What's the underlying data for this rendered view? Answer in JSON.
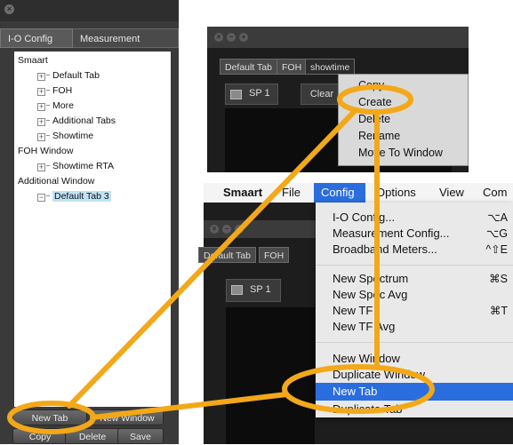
{
  "left_panel": {
    "close_glyph": "×",
    "tabs": [
      "I-O Config",
      "Measurement Config"
    ],
    "tree": [
      {
        "label": "Smaart",
        "level": 0
      },
      {
        "label": "Default Tab",
        "level": 1
      },
      {
        "label": "FOH",
        "level": 1
      },
      {
        "label": "More",
        "level": 1
      },
      {
        "label": "Additional Tabs",
        "level": 1
      },
      {
        "label": "Showtime",
        "level": 1
      },
      {
        "label": "FOH Window",
        "level": 0
      },
      {
        "label": "Showtime RTA",
        "level": 1
      },
      {
        "label": "Additional Window",
        "level": 0
      },
      {
        "label": "Default Tab 3",
        "level": 1,
        "selected": true
      }
    ],
    "buttons": {
      "new_tab": "New Tab",
      "new_window": "New Window",
      "copy": "Copy",
      "delete": "Delete",
      "save": "Save"
    }
  },
  "top_window": {
    "tabs": [
      "Default Tab",
      "FOH",
      "showtime"
    ],
    "sp_label": "SP 1",
    "clear_label": "Clear",
    "context_menu": [
      "Copy",
      "Create",
      "Delete",
      "Rename",
      "Move To Window"
    ]
  },
  "menu_bar": {
    "items": [
      "Smaart",
      "File",
      "Config",
      "Options",
      "View",
      "Com"
    ]
  },
  "bottom_window": {
    "tabs": [
      "Default Tab",
      "FOH"
    ],
    "sp_label": "SP 1"
  },
  "config_menu": {
    "items": [
      {
        "label": "I-O Config...",
        "shortcut": "⌥A"
      },
      {
        "label": "Measurement Config...",
        "shortcut": "⌥G"
      },
      {
        "label": "Broadband Meters...",
        "shortcut": "^⇧E"
      },
      {
        "label": "New Spectrum",
        "shortcut": "⌘S"
      },
      {
        "label": "New Spec Avg",
        "shortcut": ""
      },
      {
        "label": "New TF",
        "shortcut": "⌘T"
      },
      {
        "label": "New TF Avg",
        "shortcut": ""
      },
      {
        "label": "New Window",
        "shortcut": ""
      },
      {
        "label": "Duplicate Window",
        "shortcut": ""
      },
      {
        "label": "New Tab",
        "shortcut": ""
      },
      {
        "label": "Duplicate Tab",
        "shortcut": ""
      }
    ],
    "highlighted": "New Tab"
  },
  "colors": {
    "annotation": "#F2A818",
    "menu_highlight": "#2A6DDE",
    "tree_selection": "#BFE3F5",
    "window_bg": "#1D1D1D"
  }
}
